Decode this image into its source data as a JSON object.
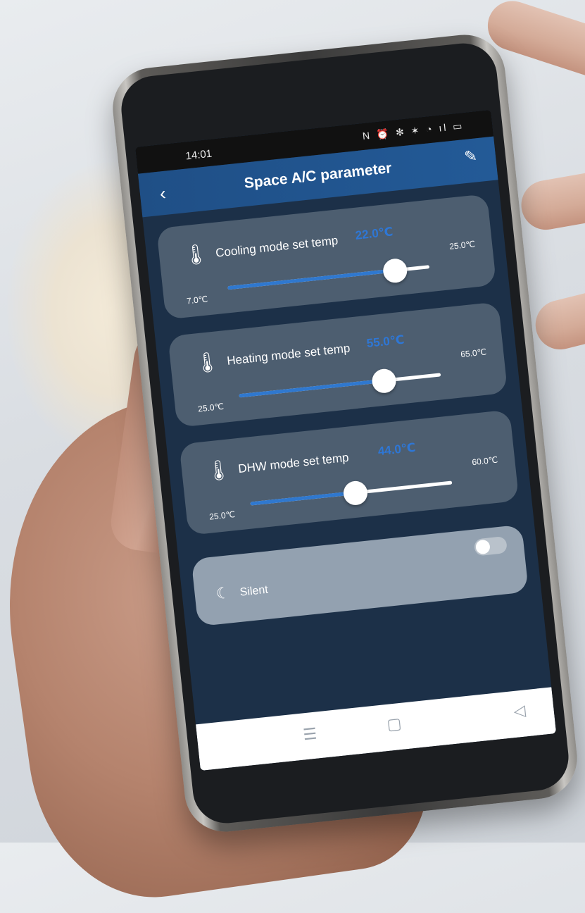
{
  "statusbar": {
    "time": "14:01",
    "icons": "N ⏰ ✻ ✶ ◔ ıl ▭"
  },
  "appbar": {
    "back_icon": "chevron-left",
    "title": "Space A/C parameter",
    "edit_icon": "pencil"
  },
  "cards": [
    {
      "label": "Cooling mode set temp",
      "value": "22.0℃",
      "min": "7.0℃",
      "max": "25.0℃",
      "fraction": 0.83
    },
    {
      "label": "Heating mode set temp",
      "value": "55.0℃",
      "min": "25.0℃",
      "max": "65.0℃",
      "fraction": 0.72
    },
    {
      "label": "DHW mode set temp",
      "value": "44.0℃",
      "min": "25.0℃",
      "max": "60.0℃",
      "fraction": 0.52
    }
  ],
  "silent": {
    "label": "Silent",
    "icon": "moon-icon",
    "toggle_on": false
  },
  "navbar": {
    "menu_icon": "☰",
    "home_icon": "▢",
    "back_icon": "◁"
  },
  "colors": {
    "accent": "#2f78cf",
    "appbar": "#1f4f86",
    "card": "#4d5e70",
    "screen_bg": "#1c3048"
  }
}
